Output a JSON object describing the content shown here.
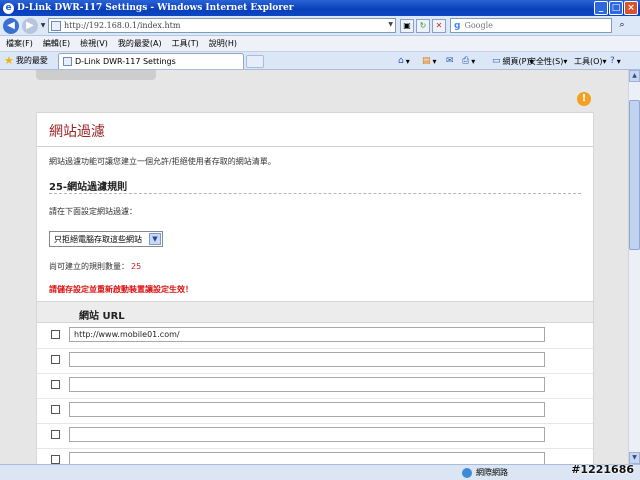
{
  "window": {
    "title": "D-Link DWR-117 Settings - Windows Internet Explorer"
  },
  "address": {
    "url": "http://192.168.0.1/index.htm"
  },
  "search": {
    "placeholder": "Google"
  },
  "menu": [
    "檔案(F)",
    "編輯(E)",
    "檢視(V)",
    "我的最愛(A)",
    "工具(T)",
    "說明(H)"
  ],
  "favorites": {
    "label": "我的最愛"
  },
  "tab": {
    "title": "D-Link DWR-117 Settings"
  },
  "commands": {
    "page": "網頁(P)",
    "safety": "安全性(S)",
    "tools": "工具(O)"
  },
  "page": {
    "title": "網站過濾",
    "description": "網站過濾功能可讓您建立一個允許/拒絕使用者存取的網站清單。",
    "section_title": "25-網站過濾規則",
    "prompt": "請在下面設定網站過濾：",
    "select_value": "只拒絕電腦存取這些網站",
    "remaining_label": "尚可建立的規則數量：",
    "remaining_count": "25",
    "warning": "請儲存設定並重新啟動裝置讓設定生效！",
    "url_header": "網站 URL",
    "rules": [
      {
        "url": "http://www.mobile01.com/"
      },
      {
        "url": ""
      },
      {
        "url": ""
      },
      {
        "url": ""
      },
      {
        "url": ""
      },
      {
        "url": ""
      }
    ]
  },
  "statusbar": {
    "zone": "網際網路"
  },
  "watermark": "#1221686"
}
